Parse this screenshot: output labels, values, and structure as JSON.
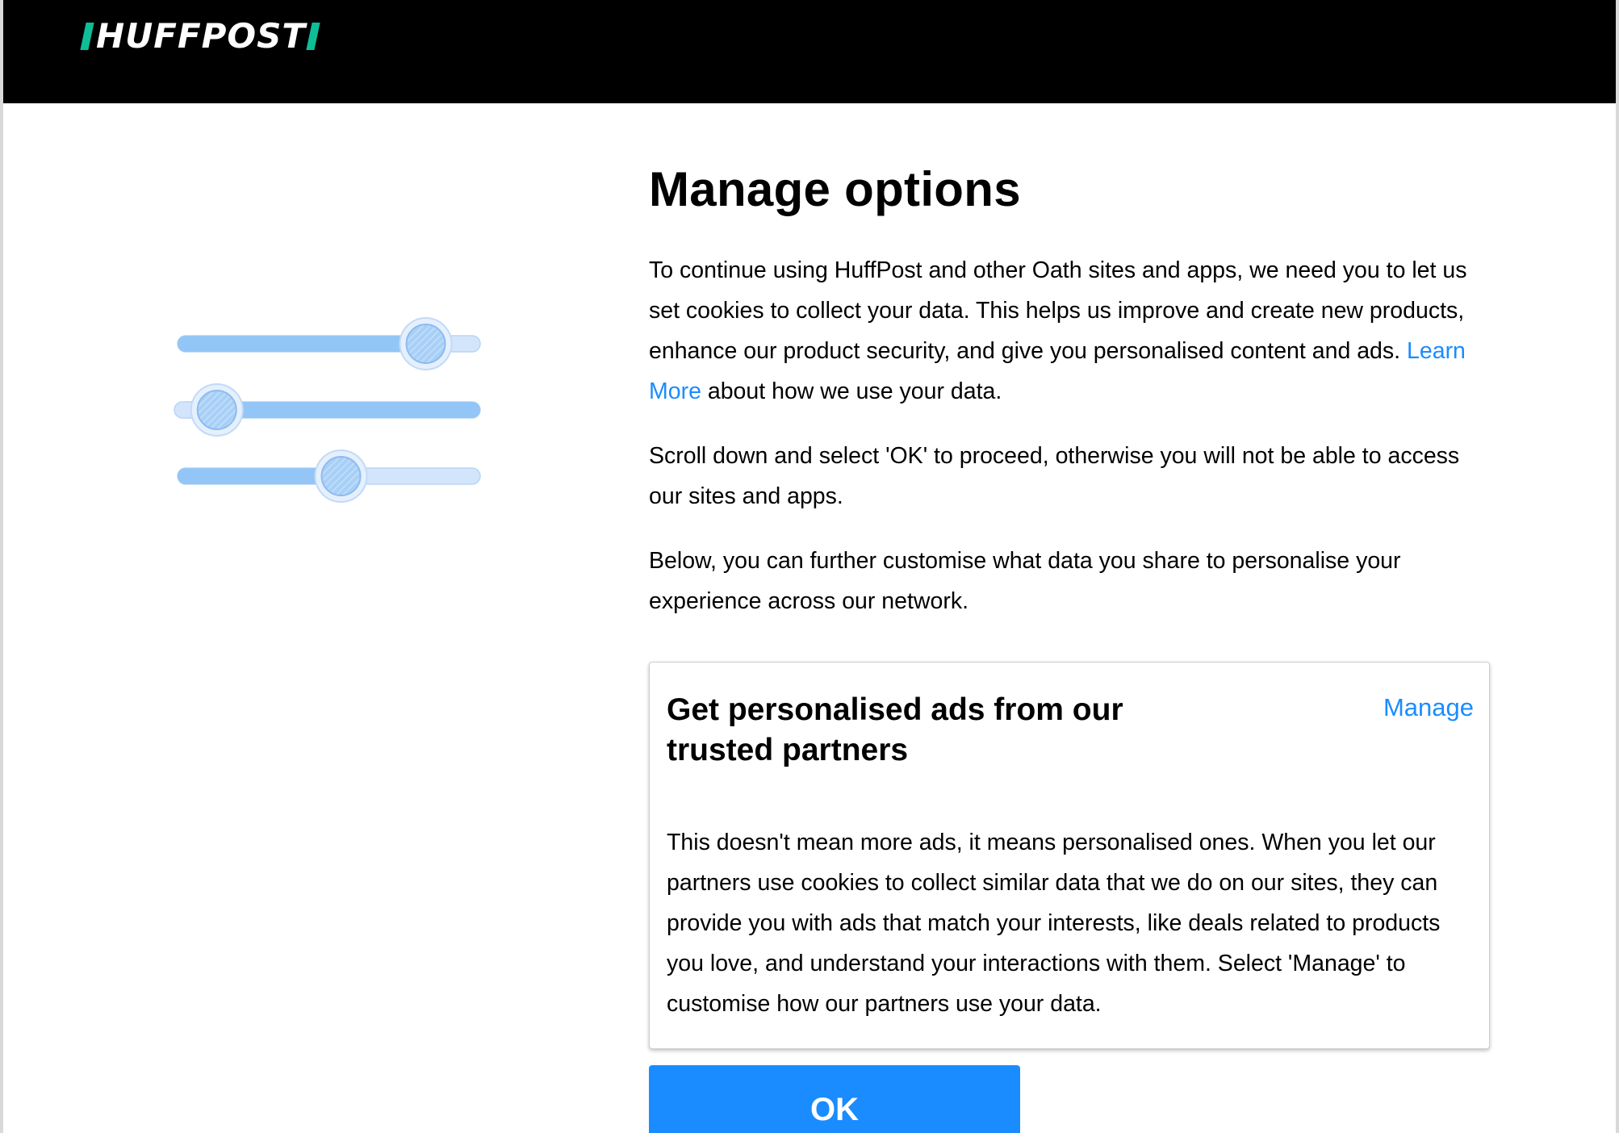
{
  "header": {
    "logo_text": "HUFFPOST",
    "background": "#000000",
    "logo_accent": "#0dbe98"
  },
  "illustration": {
    "icon": "sliders-icon",
    "sliders": [
      {
        "level": 0.82
      },
      {
        "level": 0.13
      },
      {
        "level": 0.54
      }
    ]
  },
  "main": {
    "title": "Manage options",
    "para1_before_link": "To continue using HuffPost and other Oath sites and apps, we need you to let us set cookies to collect your data. This helps us improve and create new products, enhance our product security, and give you personalised content and ads.",
    "learn_more_link": "Learn More",
    "para1_after_link": "about how we use your data.",
    "para2": "Scroll down and select 'OK' to proceed, otherwise you will not be able to access our sites and apps.",
    "para3": "Below, you can further customise what data you share to personalise your experience across our network."
  },
  "card": {
    "title": "Get personalised ads from our trusted partners",
    "manage_link": "Manage",
    "body": "This doesn't mean more ads, it means personalised ones. When you let our partners use cookies to collect similar data that we do on our sites, they can provide you with ads that match your interests, like deals related to products you love, and understand your interactions with them. Select 'Manage' to customise how our partners use your data."
  },
  "actions": {
    "ok_label": "OK"
  },
  "colors": {
    "link": "#1a8cff",
    "button": "#1a8cff",
    "slider_fill": "#93c6f7",
    "slider_track": "#d3e5fb"
  }
}
